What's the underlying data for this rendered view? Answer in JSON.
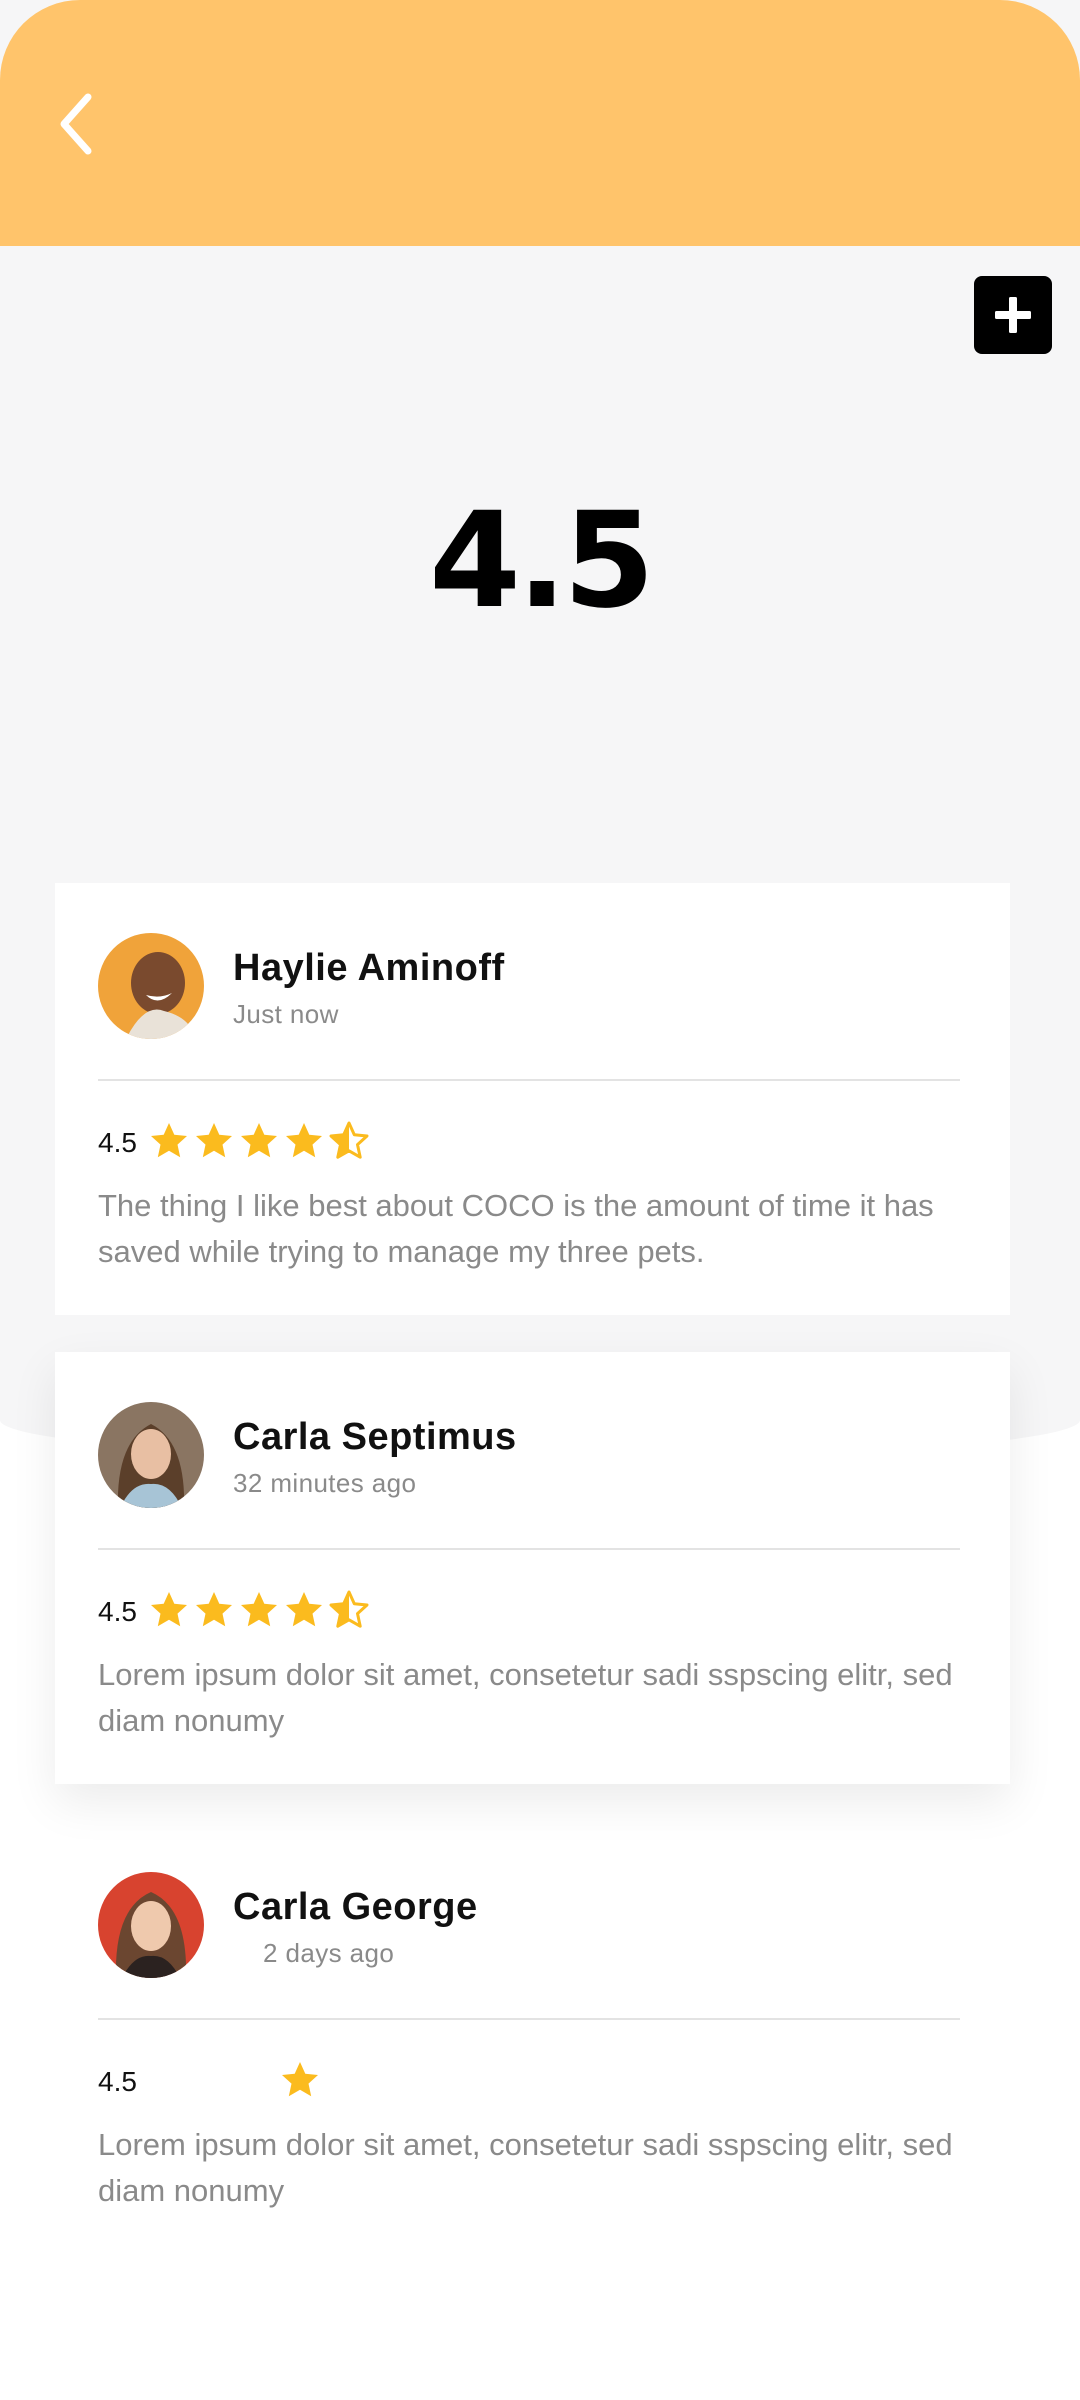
{
  "header": {
    "back_icon": "chevron-left-icon"
  },
  "toolbar": {
    "add_icon": "plus-icon"
  },
  "overall": {
    "rating": "4.5"
  },
  "colors": {
    "header": "#ffc46b",
    "star": "#fbbb1e",
    "background": "#f6f6f7"
  },
  "reviews": [
    {
      "name": "Haylie Aminoff",
      "time": "Just now",
      "score": "4.5",
      "stars": 4.5,
      "text": "The thing I like best about COCO is the amount of time it has saved while trying to manage my three pets."
    },
    {
      "name": "Carla Septimus",
      "time": "32 minutes ago",
      "score": "4.5",
      "stars": 4.5,
      "text": "Lorem ipsum dolor sit amet, consetetur sadi sspscing elitr, sed diam nonumy"
    },
    {
      "name": "Carla George",
      "time": "2 days ago",
      "score": "4.5",
      "stars": 1,
      "text": "Lorem ipsum dolor sit amet, consetetur sadi sspscing elitr, sed diam nonumy"
    }
  ]
}
